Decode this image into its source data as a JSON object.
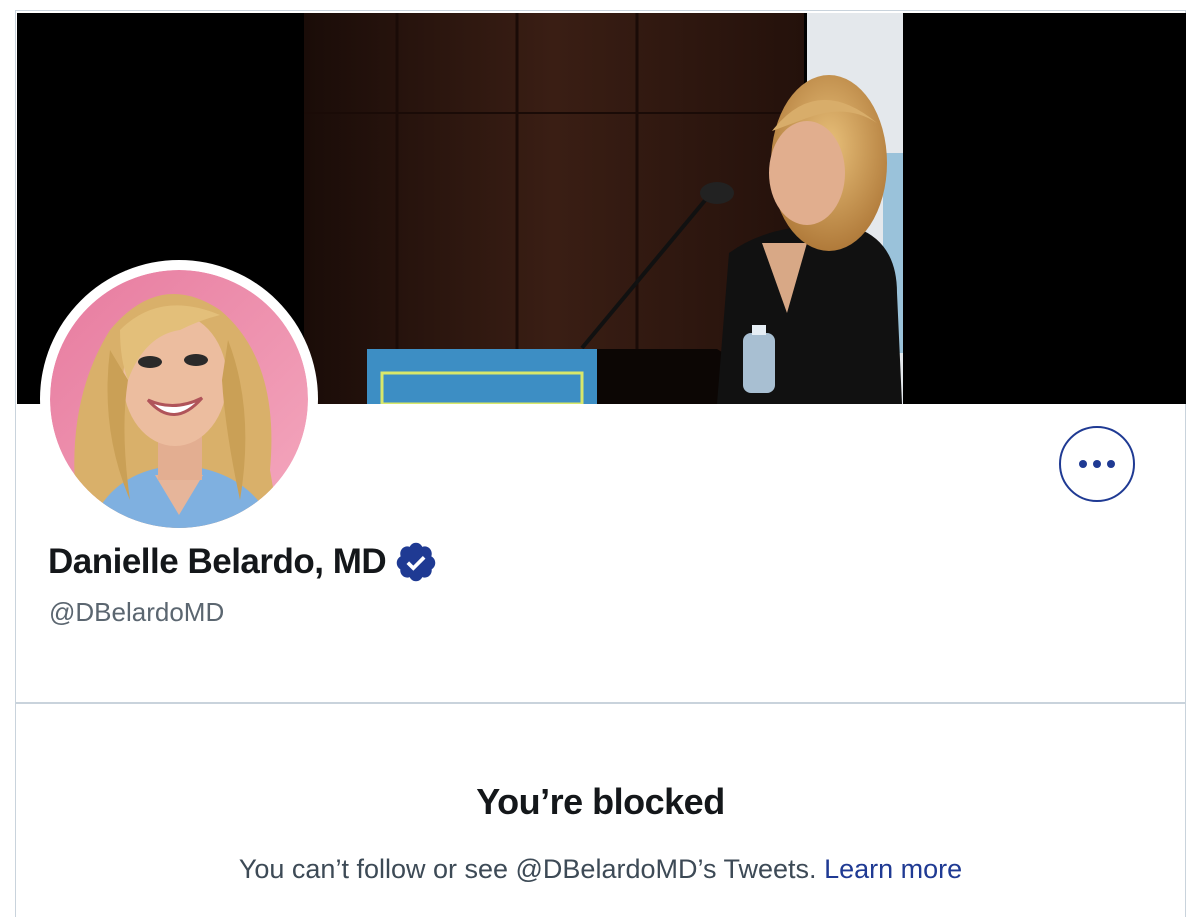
{
  "profile": {
    "display_name": "Danielle Belardo, MD",
    "handle": "@DBelardoMD",
    "verified": true
  },
  "blocked": {
    "title": "You’re blocked",
    "message": "You can’t follow or see @DBelardoMD’s Tweets.",
    "learn_more_label": "Learn more"
  },
  "icons": {
    "more": "more-horizontal-icon",
    "verified": "verified-badge-icon"
  },
  "colors": {
    "accent": "#1f3a93",
    "text_primary": "#14171a",
    "text_secondary": "#5b6670",
    "border": "#c9d3dc",
    "avatar_background": "#e88aa8"
  }
}
